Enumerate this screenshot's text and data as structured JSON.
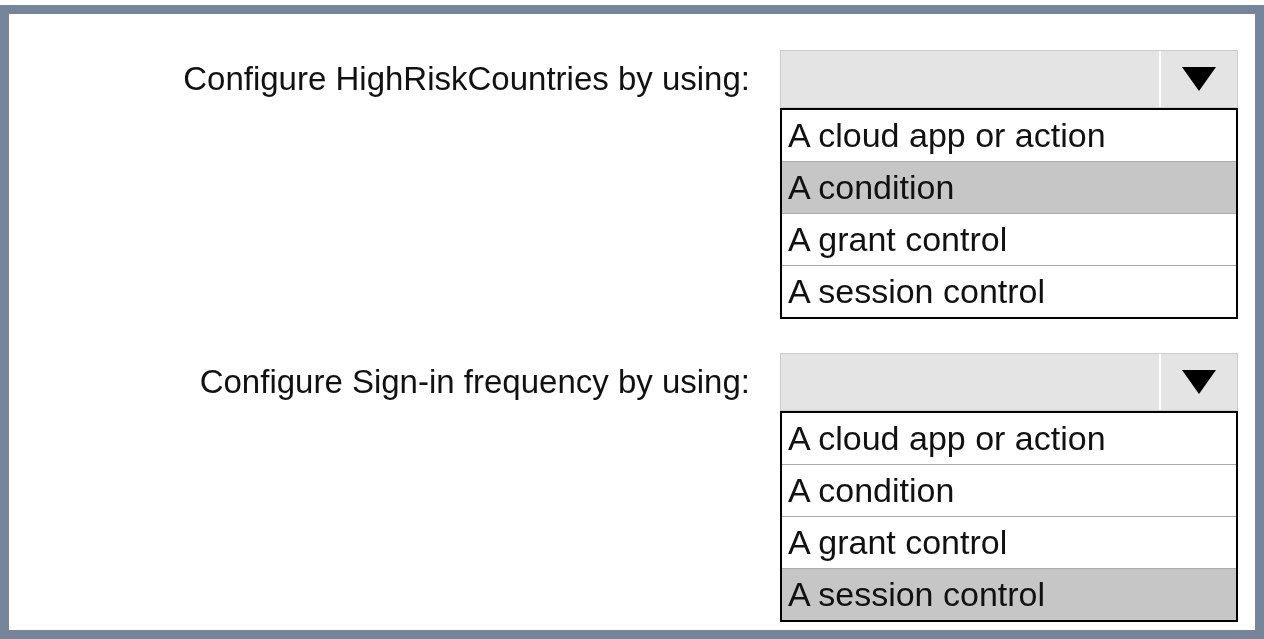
{
  "questions": [
    {
      "label": "Configure HighRiskCountries by using:",
      "options": [
        {
          "label": "A cloud app or action",
          "selected": false
        },
        {
          "label": "A condition",
          "selected": true
        },
        {
          "label": "A grant control",
          "selected": false
        },
        {
          "label": "A session control",
          "selected": false
        }
      ]
    },
    {
      "label": "Configure Sign-in frequency by using:",
      "options": [
        {
          "label": "A cloud app or action",
          "selected": false
        },
        {
          "label": "A condition",
          "selected": false
        },
        {
          "label": "A grant control",
          "selected": false
        },
        {
          "label": "A session control",
          "selected": true
        }
      ]
    }
  ]
}
